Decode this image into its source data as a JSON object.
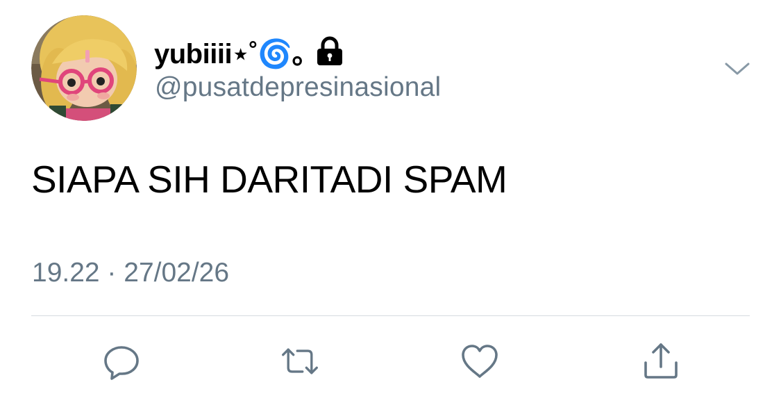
{
  "tweet": {
    "display_name": "yubiiii⋆˚🌀｡",
    "handle": "@pusatdepresinasional",
    "protected": true,
    "text": "SIAPA SIH DARITADI SPAM",
    "timestamp": "19.22 · 27/02/26"
  },
  "icons": {
    "avatar": "avatar-image",
    "lock": "lock-icon",
    "caret": "chevron-down-icon",
    "reply": "reply-icon",
    "retweet": "retweet-icon",
    "like": "heart-icon",
    "share": "share-icon"
  },
  "colors": {
    "text": "#000000",
    "secondary": "#657786",
    "icon": "#657786",
    "divider": "#d5dbe0"
  }
}
